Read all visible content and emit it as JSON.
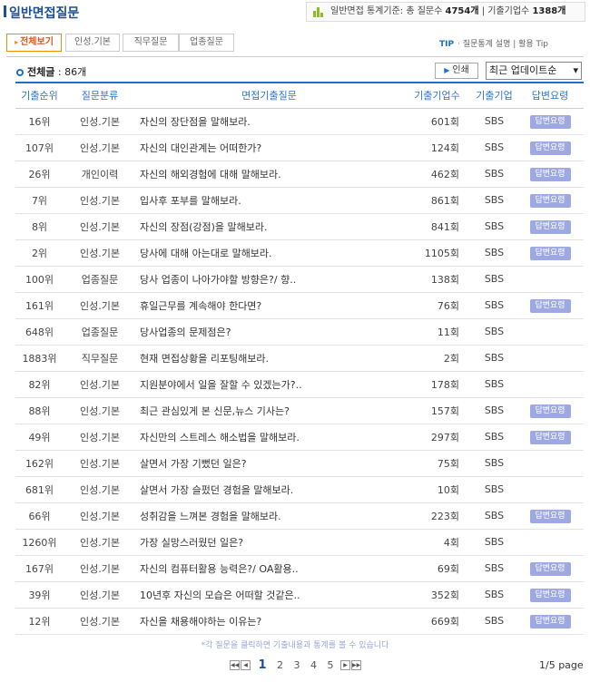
{
  "header": {
    "title": "일반면접질문",
    "stats_prefix": "일반면접 통계기준: 총 질문수 ",
    "stats_questions": "4754개",
    "stats_mid": " | 기출기업수 ",
    "stats_companies": "1388개"
  },
  "tabs": [
    "전체보기",
    "인성.기본",
    "직무질문",
    "업종질문"
  ],
  "tip": {
    "label": "TIP",
    "text": "· 질문통계 설명 | 활용 Tip"
  },
  "count": {
    "label": "전체글",
    "value": " : 86개"
  },
  "print_label": "인쇄",
  "sort": {
    "selected": "최근 업데이트순"
  },
  "table": {
    "headers": [
      "기출순위",
      "질문분류",
      "면접기출질문",
      "기출기업수",
      "기출기업",
      "답변요령"
    ],
    "answer_label": "답변요령",
    "rows": [
      {
        "rank": "16위",
        "category": "인성.기본",
        "question": "자신의 장단점을 말해보라.",
        "count": "601회",
        "company": "SBS",
        "answer": true
      },
      {
        "rank": "107위",
        "category": "인성.기본",
        "question": "자신의 대인관계는 어떠한가?",
        "count": "124회",
        "company": "SBS",
        "answer": true
      },
      {
        "rank": "26위",
        "category": "개인이력",
        "question": "자신의 해외경험에 대해 말해보라.",
        "count": "462회",
        "company": "SBS",
        "answer": true
      },
      {
        "rank": "7위",
        "category": "인성.기본",
        "question": "입사후 포부를 말해보라.",
        "count": "861회",
        "company": "SBS",
        "answer": true
      },
      {
        "rank": "8위",
        "category": "인성.기본",
        "question": "자신의 장점(강점)을 말해보라.",
        "count": "841회",
        "company": "SBS",
        "answer": true
      },
      {
        "rank": "2위",
        "category": "인성.기본",
        "question": "당사에 대해 아는대로 말해보라.",
        "count": "1105회",
        "company": "SBS",
        "answer": true
      },
      {
        "rank": "100위",
        "category": "업종질문",
        "question": "당사 업종이 나아가야할 방향은?/ 향..",
        "count": "138회",
        "company": "SBS",
        "answer": false
      },
      {
        "rank": "161위",
        "category": "인성.기본",
        "question": "휴일근무를 계속해야 한다면?",
        "count": "76회",
        "company": "SBS",
        "answer": true
      },
      {
        "rank": "648위",
        "category": "업종질문",
        "question": "당사업종의 문제점은?",
        "count": "11회",
        "company": "SBS",
        "answer": false
      },
      {
        "rank": "1883위",
        "category": "직무질문",
        "question": "현재 면접상황을 리포팅해보라.",
        "count": "2회",
        "company": "SBS",
        "answer": false
      },
      {
        "rank": "82위",
        "category": "인성.기본",
        "question": "지원분야에서 일을 잘할 수 있겠는가?..",
        "count": "178회",
        "company": "SBS",
        "answer": false
      },
      {
        "rank": "88위",
        "category": "인성.기본",
        "question": "최근 관심있게 본 신문,뉴스 기사는?",
        "count": "157회",
        "company": "SBS",
        "answer": true
      },
      {
        "rank": "49위",
        "category": "인성.기본",
        "question": "자신만의 스트레스 해소법을 말해보라.",
        "count": "297회",
        "company": "SBS",
        "answer": true
      },
      {
        "rank": "162위",
        "category": "인성.기본",
        "question": "살면서 가장 기뻤던 일은?",
        "count": "75회",
        "company": "SBS",
        "answer": false
      },
      {
        "rank": "681위",
        "category": "인성.기본",
        "question": "살면서 가장 슬펐던 경험을 말해보라.",
        "count": "10회",
        "company": "SBS",
        "answer": false
      },
      {
        "rank": "66위",
        "category": "인성.기본",
        "question": "성취감을 느껴본 경험을 말해보라.",
        "count": "223회",
        "company": "SBS",
        "answer": true
      },
      {
        "rank": "1260위",
        "category": "인성.기본",
        "question": "가장 실망스러웠던 일은?",
        "count": "4회",
        "company": "SBS",
        "answer": false
      },
      {
        "rank": "167위",
        "category": "인성.기본",
        "question": "자신의 컴퓨터활용 능력은?/ OA활용..",
        "count": "69회",
        "company": "SBS",
        "answer": true
      },
      {
        "rank": "39위",
        "category": "인성.기본",
        "question": "10년후 자신의 모습은 어떠할 것같은..",
        "count": "352회",
        "company": "SBS",
        "answer": true
      },
      {
        "rank": "12위",
        "category": "인성.기본",
        "question": "자신을 채용해야하는 이유는?",
        "count": "669회",
        "company": "SBS",
        "answer": true
      }
    ]
  },
  "note": "*각 질문을 클릭하면 기출내용과 통계를 볼 수 있습니다",
  "pagination": {
    "pages": [
      "1",
      "2",
      "3",
      "4",
      "5"
    ],
    "current": "1",
    "info": "1/5 page"
  }
}
